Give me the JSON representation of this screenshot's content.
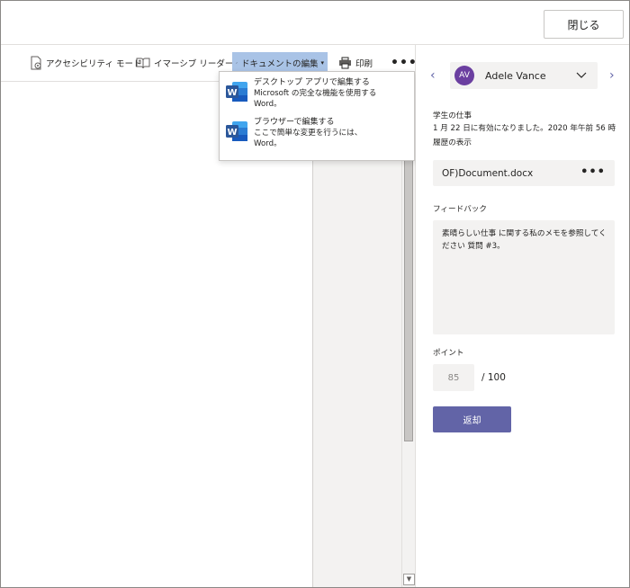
{
  "header": {
    "close_label": "閉じる"
  },
  "toolbar": {
    "accessibility_label": "アクセシビリティ モード",
    "immersive_label": "イマーシブ リーダー",
    "edit_label": "ドキュメントの編集",
    "print_label": "印刷",
    "more_label": "•••"
  },
  "edit_menu": {
    "items": [
      {
        "title": "デスクトップ アプリで編集する",
        "line2": "Microsoft の完全な機能を使用する",
        "line3": "Word。"
      },
      {
        "title": "ブラウザーで編集する",
        "line2": "ここで簡単な変更を行うには、",
        "line3": "Word。"
      }
    ]
  },
  "student": {
    "initials": "AV",
    "name": "Adele Vance",
    "prev_arrow": "‹",
    "next_arrow": "›"
  },
  "work": {
    "heading": "学生の仕事",
    "status": "1 月 22 日に有効になりました。2020 年午前 56 時",
    "history": "履歴の表示"
  },
  "file": {
    "name": "OF)Document.docx",
    "more": "•••"
  },
  "feedback": {
    "label": "フィードバック",
    "text": "素晴らしい仕事 に関する私のメモを参照してください 質問 #3。"
  },
  "points": {
    "label": "ポイント",
    "value": "85",
    "max": "/ 100"
  },
  "return_label": "返却",
  "colors": {
    "accent": "#6264a7",
    "avatar": "#6b3fa0",
    "word_blue": "#2b579a"
  }
}
